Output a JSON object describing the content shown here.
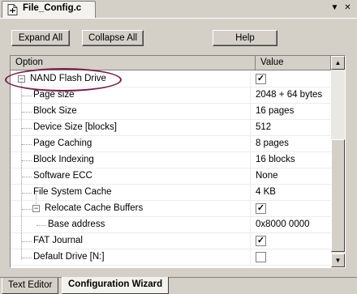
{
  "window": {
    "file_tab": "File_Config.c",
    "dropdown_glyph": "▼",
    "close_glyph": "✕"
  },
  "toolbar": {
    "expand_all": "Expand All",
    "collapse_all": "Collapse All",
    "help": "Help"
  },
  "grid": {
    "columns": {
      "option": "Option",
      "value": "Value"
    },
    "rows": [
      {
        "label": "NAND Flash Drive",
        "checked": true
      },
      {
        "label": "Page size",
        "value": "2048 + 64 bytes"
      },
      {
        "label": "Block Size",
        "value": "16 pages"
      },
      {
        "label": "Device Size [blocks]",
        "value": "512"
      },
      {
        "label": "Page Caching",
        "value": "8 pages"
      },
      {
        "label": "Block Indexing",
        "value": "16 blocks"
      },
      {
        "label": "Software ECC",
        "value": "None"
      },
      {
        "label": "File System Cache",
        "value": "4 KB"
      },
      {
        "label": "Relocate Cache Buffers",
        "checked": true
      },
      {
        "label": "Base address",
        "value": "0x8000 0000"
      },
      {
        "label": "FAT Journal",
        "checked": true
      },
      {
        "label": "Default Drive [N:]",
        "checked": false
      }
    ]
  },
  "bottom_tabs": {
    "text_editor": "Text Editor",
    "configuration_wizard": "Configuration Wizard"
  },
  "colors": {
    "annotation": "#7b1e4a",
    "face": "#d4d0c8"
  },
  "icons": {
    "file": "file-icon",
    "dropdown": "dropdown-arrow-icon",
    "close": "close-icon",
    "collapse": "tree-collapse-icon",
    "check": "checkmark-icon"
  }
}
